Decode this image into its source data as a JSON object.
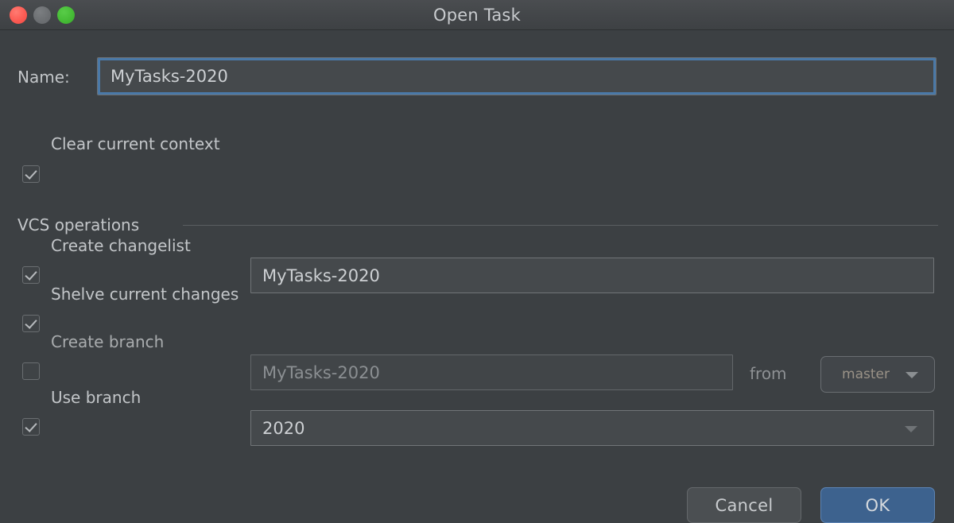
{
  "window": {
    "title": "Open Task",
    "traffic_lights": [
      {
        "name": "close",
        "color": "#fc5b53"
      },
      {
        "name": "minimize",
        "color": "#6d7073"
      },
      {
        "name": "maximize",
        "color": "#46bc36"
      }
    ]
  },
  "form": {
    "name_label": "Name:",
    "name_value": "MyTasks-2020",
    "clear_context": {
      "label": "Clear current context",
      "checked": true
    }
  },
  "vcs": {
    "section_title": "VCS operations",
    "create_changelist": {
      "label": "Create changelist",
      "checked": true,
      "value": "MyTasks-2020"
    },
    "shelve_changes": {
      "label": "Shelve current changes",
      "checked": true
    },
    "create_branch": {
      "label": "Create branch",
      "checked": false,
      "value": "MyTasks-2020",
      "from_label": "from",
      "from_value": "master"
    },
    "use_branch": {
      "label": "Use branch",
      "checked": true,
      "value": "2020"
    }
  },
  "buttons": {
    "cancel": "Cancel",
    "ok": "OK"
  },
  "colors": {
    "background": "#3c4043",
    "accent_focus": "#4a79a8",
    "ok_button": "#3d628e"
  }
}
